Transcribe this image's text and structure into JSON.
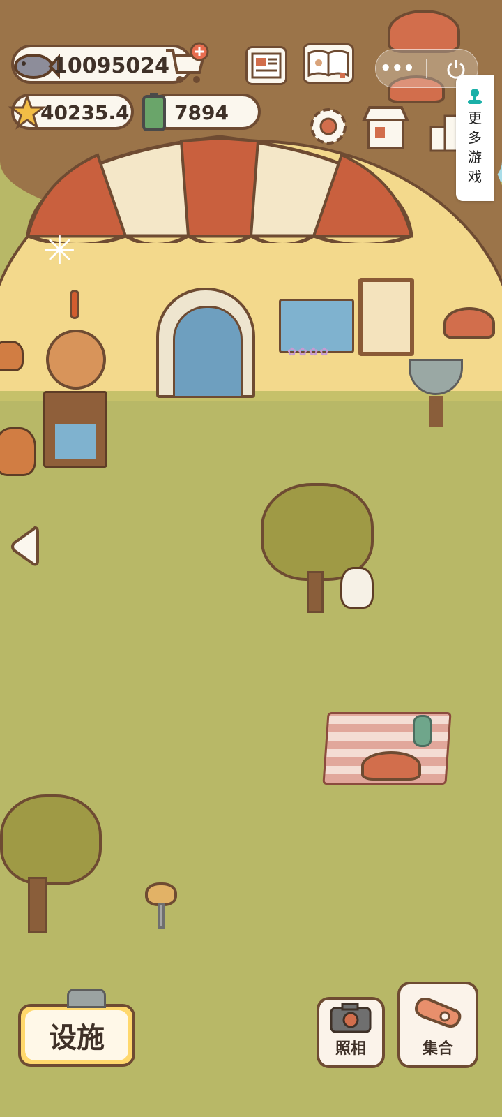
{
  "resources": {
    "fish": {
      "icon": "fish-icon",
      "value": "10095024"
    },
    "star": {
      "icon": "star-icon",
      "value": "40235.4"
    },
    "battery": {
      "icon": "battery-icon",
      "value": "7894"
    }
  },
  "toolbar_icons": [
    "shop-cart-plus-icon",
    "newspaper-icon",
    "paw-book-icon",
    "settings-gear-icon",
    "store-icon",
    "leaderboard-icon"
  ],
  "mini_program": {
    "menu_icon": "more-dots-icon",
    "close_icon": "power-icon"
  },
  "more_games": {
    "icon": "joystick-icon",
    "chars": [
      "更",
      "多",
      "游",
      "戏"
    ]
  },
  "buttons": {
    "facilities": "设施",
    "photo": "照相",
    "gather": "集合"
  },
  "colors": {
    "grass": "#b8b867",
    "outline": "#6e4b32",
    "awning_red": "#c9603e",
    "awning_cream": "#f4e7c8",
    "button_yellow": "#ffd86c"
  }
}
